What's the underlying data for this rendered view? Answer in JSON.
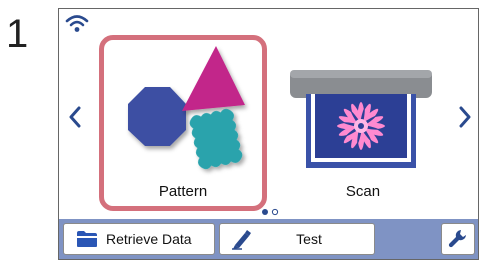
{
  "step": {
    "number": "1"
  },
  "status": {
    "wifi_icon": "wifi-icon"
  },
  "navigation": {
    "prev_icon": "chevron-left-icon",
    "next_icon": "chevron-right-icon"
  },
  "tiles": [
    {
      "label": "Pattern",
      "icon": "pattern-shapes-icon",
      "selected": true
    },
    {
      "label": "Scan",
      "icon": "scanner-icon",
      "selected": false
    }
  ],
  "pagination": {
    "current_page": 1,
    "total_pages": 2
  },
  "toolbar": {
    "retrieve_label": "Retrieve Data",
    "retrieve_icon": "folder-icon",
    "test_label": "Test",
    "test_icon": "pen-icon",
    "settings_icon": "wrench-icon"
  },
  "colors": {
    "accent": "#d4707c",
    "nav_blue": "#2a4a8e",
    "toolbar_bg": "#7f93c4",
    "octagon": "#3c4fa3",
    "triangle": "#c2288a",
    "stamp": "#2aa3ac"
  }
}
